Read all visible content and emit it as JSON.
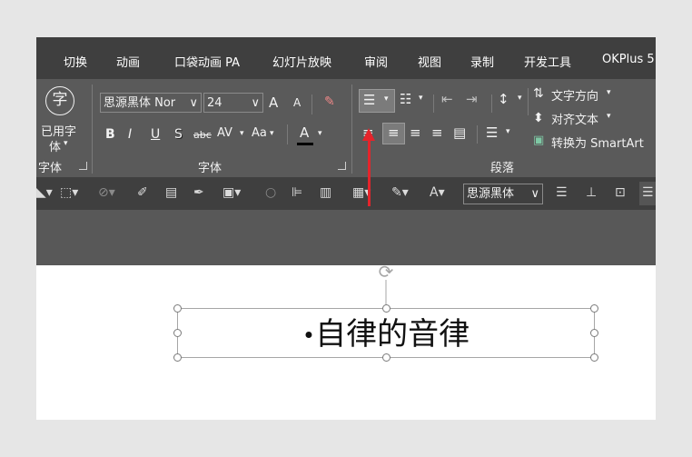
{
  "tabs": [
    "切换",
    "动画",
    "口袋动画 PA",
    "幻灯片放映",
    "审阅",
    "视图",
    "录制",
    "开发工具",
    "OKPlus 5"
  ],
  "ribbon": {
    "char_icon_glyph": "字",
    "used_fonts_label": "已用字",
    "used_fonts_label2": "体",
    "dropdown_glyph": "▾",
    "font_name": "思源黑体 Nor",
    "font_size": "24",
    "grow_font": "A",
    "shrink_font": "A",
    "bold": "B",
    "italic": "I",
    "underline": "U",
    "shadow": "S",
    "strikethrough": "abc",
    "char_spacing": "AV",
    "change_case": "Aa",
    "font_color_letter": "A",
    "group_font_left": "字体",
    "group_font": "字体",
    "group_paragraph": "段落",
    "text_direction": "文字方向",
    "align_text": "对齐文本",
    "convert_smartart": "转换为 SmartArt"
  },
  "toolbar": {
    "font_name": "思源黑体"
  },
  "slide": {
    "bullet": "•",
    "text": "自律的音律"
  },
  "colors": {
    "tab_bar": "#3f3f3f",
    "ribbon": "#5a5a5a",
    "arrow": "#e5242b",
    "font_color_bar": "#000000"
  }
}
